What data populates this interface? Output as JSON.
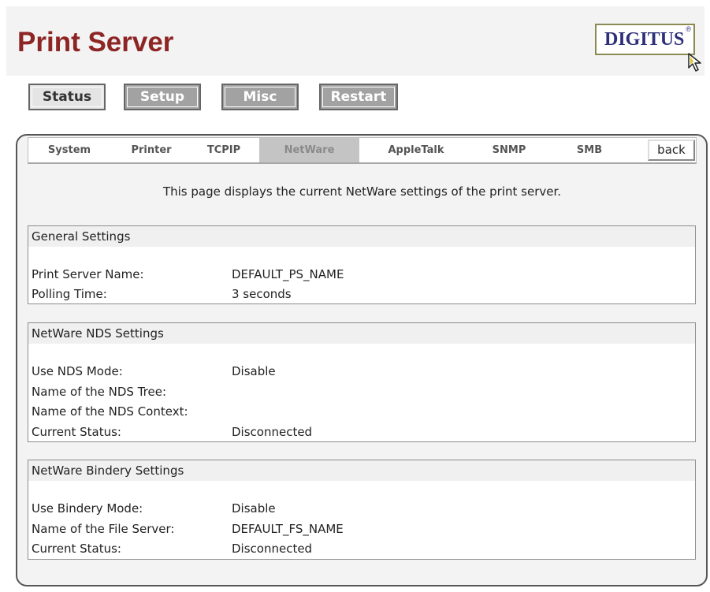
{
  "header": {
    "title": "Print Server",
    "logo_text": "DIGITUS",
    "logo_mark": "®"
  },
  "top_buttons": [
    {
      "label": "Status",
      "selected": true
    },
    {
      "label": "Setup",
      "selected": false
    },
    {
      "label": "Misc",
      "selected": false
    },
    {
      "label": "Restart",
      "selected": false
    }
  ],
  "tabs": [
    {
      "label": "System",
      "active": false
    },
    {
      "label": "Printer",
      "active": false
    },
    {
      "label": "TCPIP",
      "active": false
    },
    {
      "label": "NetWare",
      "active": true
    },
    {
      "label": "AppleTalk",
      "active": false
    },
    {
      "label": "SNMP",
      "active": false
    },
    {
      "label": "SMB",
      "active": false
    }
  ],
  "back_label": "back",
  "intro": "This page displays the current NetWare settings of the print server.",
  "sections": [
    {
      "title": "General Settings",
      "rows": [
        {
          "label": "Print Server Name:",
          "value": "DEFAULT_PS_NAME"
        },
        {
          "label": "Polling Time:",
          "value": "3 seconds"
        }
      ]
    },
    {
      "title": "NetWare NDS Settings",
      "rows": [
        {
          "label": "Use NDS Mode:",
          "value": "Disable"
        },
        {
          "label": "Name of the NDS Tree:",
          "value": ""
        },
        {
          "label": "Name of the NDS Context:",
          "value": ""
        },
        {
          "label": "Current Status:",
          "value": "Disconnected"
        }
      ]
    },
    {
      "title": "NetWare Bindery Settings",
      "rows": [
        {
          "label": "Use Bindery Mode:",
          "value": "Disable"
        },
        {
          "label": "Name of the File Server:",
          "value": "DEFAULT_FS_NAME"
        },
        {
          "label": "Current Status:",
          "value": "Disconnected"
        }
      ]
    }
  ],
  "colors": {
    "title": "#8e2525",
    "logo": "#2d2f79",
    "button_selected": "#e4e4e4",
    "button_normal": "#a2a2a2",
    "tab_active": "#c4c4c4"
  },
  "icons": {
    "logo_cursor": "cursor-arrow-icon"
  }
}
